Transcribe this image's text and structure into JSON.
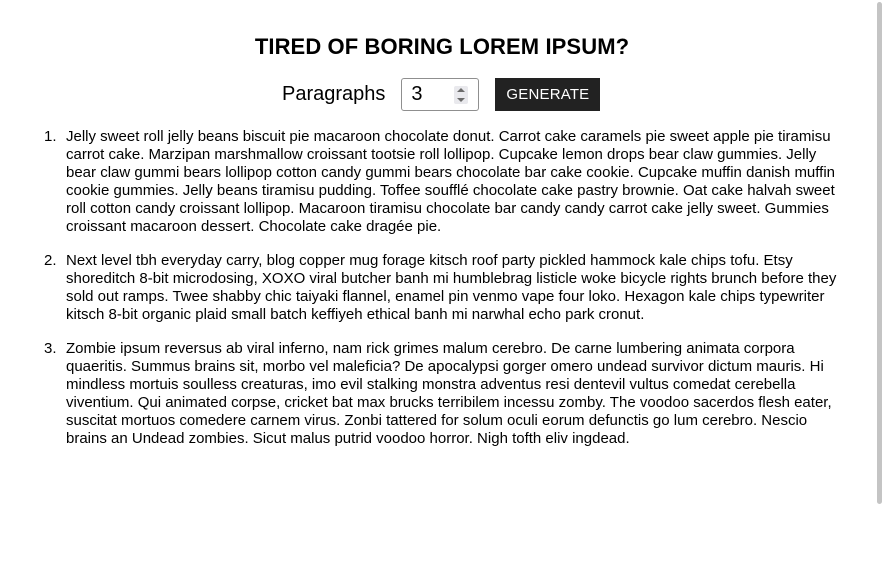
{
  "header": {
    "title": "TIRED OF BORING LOREM IPSUM?"
  },
  "controls": {
    "paragraphs_label": "Paragraphs",
    "paragraphs_value": "3",
    "generate_label": "GENERATE"
  },
  "paragraphs": [
    {
      "number": "1.",
      "text": "Jelly sweet roll jelly beans biscuit pie macaroon chocolate donut. Carrot cake caramels pie sweet apple pie tiramisu carrot cake. Marzipan marshmallow croissant tootsie roll lollipop. Cupcake lemon drops bear claw gummies. Jelly bear claw gummi bears lollipop cotton candy gummi bears chocolate bar cake cookie. Cupcake muffin danish muffin cookie gummies. Jelly beans tiramisu pudding. Toffee soufflé chocolate cake pastry brownie. Oat cake halvah sweet roll cotton candy croissant lollipop. Macaroon tiramisu chocolate bar candy candy carrot cake jelly sweet. Gummies croissant macaroon dessert. Chocolate cake dragée pie."
    },
    {
      "number": "2.",
      "text": "Next level tbh everyday carry, blog copper mug forage kitsch roof party pickled hammock kale chips tofu. Etsy shoreditch 8-bit microdosing, XOXO viral butcher banh mi humblebrag listicle woke bicycle rights brunch before they sold out ramps. Twee shabby chic taiyaki flannel, enamel pin venmo vape four loko. Hexagon kale chips typewriter kitsch 8-bit organic plaid small batch keffiyeh ethical banh mi narwhal echo park cronut."
    },
    {
      "number": "3.",
      "text": "Zombie ipsum reversus ab viral inferno, nam rick grimes malum cerebro. De carne lumbering animata corpora quaeritis. Summus brains sit, morbo vel maleficia? De apocalypsi gorger omero undead survivor dictum mauris. Hi mindless mortuis soulless creaturas, imo evil stalking monstra adventus resi dentevil vultus comedat cerebella viventium. Qui animated corpse, cricket bat max brucks terribilem incessu zomby. The voodoo sacerdos flesh eater, suscitat mortuos comedere carnem virus. Zonbi tattered for solum oculi eorum defunctis go lum cerebro. Nescio brains an Undead zombies. Sicut malus putrid voodoo horror. Nigh tofth eliv ingdead."
    }
  ]
}
